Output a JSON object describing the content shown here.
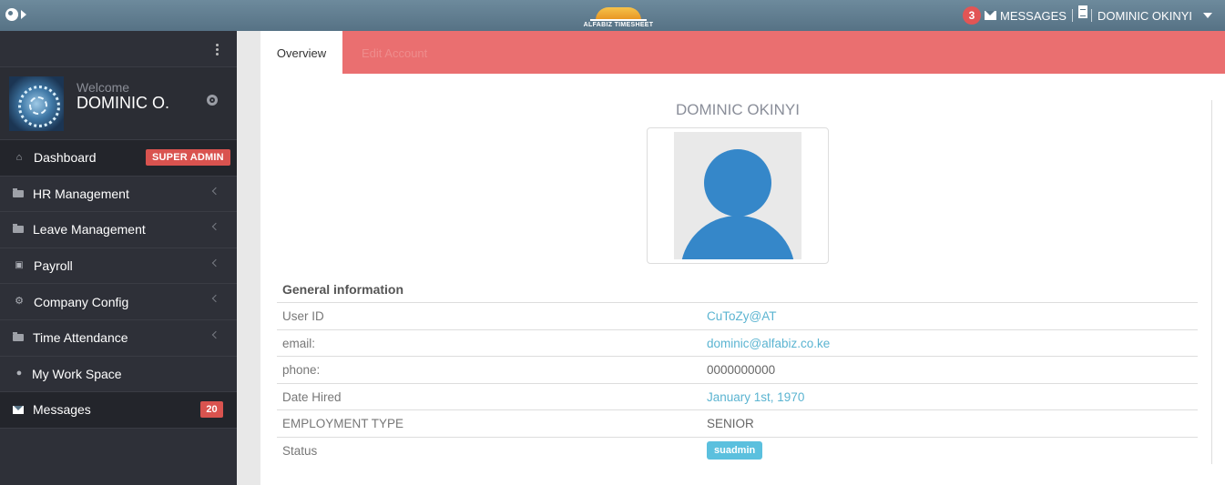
{
  "topbar": {
    "logo_text": "ALFABIZ TIMESHEET",
    "message_count": "3",
    "messages_label": "MESSAGES",
    "user_name": "DOMINIC OKINYI"
  },
  "sidebar": {
    "welcome": "Welcome",
    "user_short": "DOMINIC O.",
    "items": [
      {
        "label": "Dashboard",
        "badge": "SUPER ADMIN"
      },
      {
        "label": "HR Management"
      },
      {
        "label": "Leave Management"
      },
      {
        "label": "Payroll"
      },
      {
        "label": "Company Config"
      },
      {
        "label": "Time Attendance"
      },
      {
        "label": "My Work Space"
      },
      {
        "label": "Messages",
        "badge": "20"
      }
    ]
  },
  "tabs": {
    "overview": "Overview",
    "edit": "Edit Account"
  },
  "profile": {
    "name": "DOMINIC OKINYI",
    "section_title": "General information",
    "rows": [
      {
        "key": "User ID",
        "value": "CuToZy@AT"
      },
      {
        "key": "email:",
        "value": "dominic@alfabiz.co.ke"
      },
      {
        "key": "phone:",
        "value": "0000000000"
      },
      {
        "key": "Date Hired",
        "value": "January 1st, 1970"
      },
      {
        "key": "EMPLOYMENT TYPE",
        "value": "SENIOR"
      },
      {
        "key": "Status",
        "value": "suadmin"
      }
    ]
  },
  "colors": {
    "topbar": "#5e7b8e",
    "sidebar": "#2e3038",
    "tabbar": "#ea6f70",
    "badge_red": "#d9534f",
    "link": "#5bb4d1",
    "status_label": "#5bc0de"
  }
}
